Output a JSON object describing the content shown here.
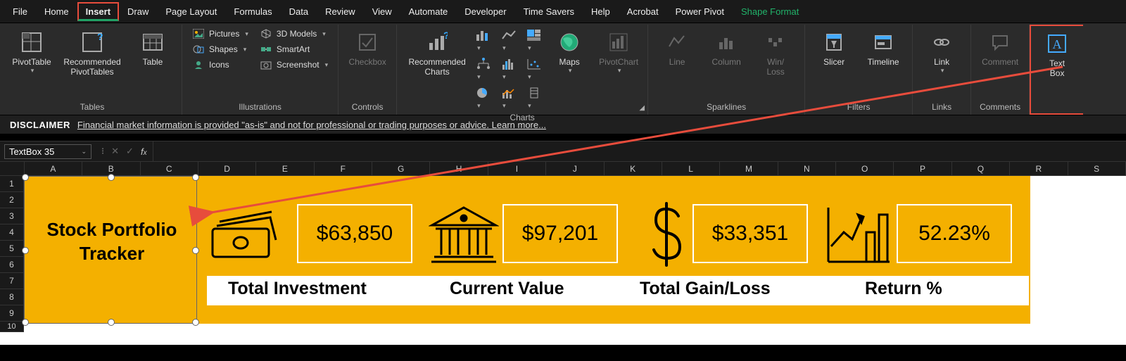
{
  "menubar": {
    "tabs": [
      "File",
      "Home",
      "Insert",
      "Draw",
      "Page Layout",
      "Formulas",
      "Data",
      "Review",
      "View",
      "Automate",
      "Developer",
      "Time Savers",
      "Help",
      "Acrobat",
      "Power Pivot",
      "Shape Format"
    ],
    "active_index": 2,
    "shape_format_index": 15
  },
  "ribbon": {
    "groups": {
      "tables": {
        "label": "Tables",
        "pivot": "PivotTable",
        "rec": "Recommended PivotTables",
        "table": "Table"
      },
      "illus": {
        "label": "Illustrations",
        "pictures": "Pictures",
        "shapes": "Shapes",
        "icons": "Icons",
        "models": "3D Models",
        "smartart": "SmartArt",
        "screenshot": "Screenshot"
      },
      "controls": {
        "label": "Controls",
        "checkbox": "Checkbox"
      },
      "charts": {
        "label": "Charts",
        "rec": "Recommended Charts",
        "maps": "Maps",
        "pivotchart": "PivotChart"
      },
      "spark": {
        "label": "Sparklines",
        "line": "Line",
        "col": "Column",
        "wl": "Win/\nLoss"
      },
      "filters": {
        "label": "Filters",
        "slicer": "Slicer",
        "timeline": "Timeline"
      },
      "links": {
        "label": "Links",
        "link": "Link"
      },
      "comments": {
        "label": "Comments",
        "comment": "Comment"
      },
      "text": {
        "label": "",
        "textbox": "Text Box"
      }
    }
  },
  "disclaimer": {
    "lead": "DISCLAIMER",
    "text": "Financial market information is provided \"as-is\" and not for professional or trading purposes or advice. Learn more..."
  },
  "namebox": {
    "value": "TextBox 35"
  },
  "columns": [
    "A",
    "B",
    "C",
    "D",
    "E",
    "F",
    "G",
    "H",
    "I",
    "J",
    "K",
    "L",
    "M",
    "N",
    "O",
    "P",
    "Q",
    "R",
    "S"
  ],
  "rows": [
    "1",
    "2",
    "3",
    "4",
    "5",
    "6",
    "7",
    "8",
    "9",
    "10"
  ],
  "dashboard": {
    "title": "Stock Portfolio Tracker",
    "metrics": [
      {
        "value": "$63,850",
        "label": "Total Investment"
      },
      {
        "value": "$97,201",
        "label": "Current Value"
      },
      {
        "value": "$33,351",
        "label": "Total Gain/Loss"
      },
      {
        "value": "52.23%",
        "label": "Return %"
      }
    ]
  }
}
